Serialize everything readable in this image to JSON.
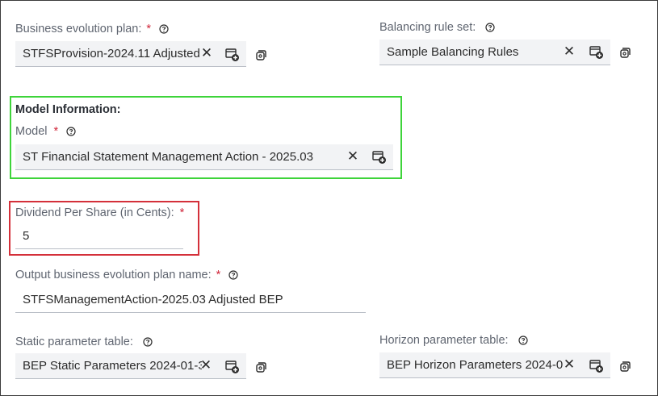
{
  "bep": {
    "label": "Business evolution plan:",
    "required": "*",
    "value": "STFSProvision-2024.11 Adjusted"
  },
  "balancing": {
    "label": "Balancing rule set:",
    "value": "Sample Balancing Rules"
  },
  "model_section": {
    "heading": "Model Information:",
    "label": "Model",
    "required": "*",
    "value": "ST Financial Statement Management Action - 2025.03"
  },
  "dividend": {
    "label": "Dividend Per Share (in Cents):",
    "required": "*",
    "value": "5"
  },
  "output_bep": {
    "label": "Output business evolution plan name:",
    "required": "*",
    "value": "STFSManagementAction-2025.03 Adjusted BEP"
  },
  "static_table": {
    "label": "Static parameter table:",
    "value": "BEP Static Parameters 2024-01-3"
  },
  "horizon_table": {
    "label": "Horizon parameter table:",
    "value": "BEP Horizon Parameters 2024-0"
  },
  "icons": {
    "help": "question-circle-icon",
    "clear": "close-icon",
    "add": "add-table-icon",
    "reset": "reset-icon"
  },
  "colors": {
    "required": "#d0263a",
    "highlight_green": "#3ed43a",
    "highlight_red": "#d4303a",
    "field_bg": "#f2f3f5"
  }
}
